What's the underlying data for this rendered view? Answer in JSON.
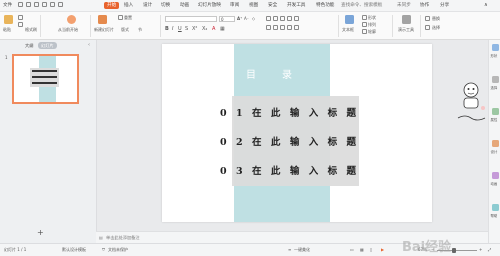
{
  "menubar": {
    "file_label": "文件",
    "tabs": [
      "开始",
      "插入",
      "设计",
      "切换",
      "动画",
      "幻灯片放映",
      "审阅",
      "视图",
      "安全",
      "开发工具",
      "特色功能"
    ],
    "search_placeholder": "查找命令、搜索模板",
    "sync_label": "未同步",
    "collab_label": "协作",
    "share_label": "分享"
  },
  "ribbon": {
    "paste_label": "粘贴",
    "format_painter_label": "格式刷",
    "current_page_label": "从当前开始",
    "new_slide_label": "新建幻灯片",
    "layout_label": "版式",
    "section_label": "节",
    "reset_label": "重置",
    "textbox_label": "文本框",
    "shape_label": "形状",
    "arrange_label": "排列",
    "outline_label": "轮廓",
    "presenter_label": "演示工具",
    "replace_label": "替换",
    "select_label": "选择",
    "font_size_value": "0",
    "font_name_value": ""
  },
  "leftpanel": {
    "tab_outline": "大纲",
    "tab_slides": "幻灯片",
    "thumb_number": "1",
    "add_slide_symbol": "+"
  },
  "slide": {
    "title": "目录",
    "rows": [
      "01在此输入标题",
      "02在此输入标题",
      "03在此输入标题"
    ]
  },
  "notes": {
    "placeholder": "单击此处添加备注"
  },
  "rightbar": {
    "items": [
      "形状",
      "选择",
      "属性",
      "设计",
      "动画",
      "帮助"
    ]
  },
  "statusbar": {
    "slide_indicator": "幻灯片 1 / 1",
    "theme_name": "默认设计模板",
    "protect_label": "文档未保护",
    "beautify_label": "一键美化",
    "zoom_value": "67%"
  },
  "watermark": {
    "text": "Bai经验"
  },
  "colors": {
    "accent": "#e8632d",
    "teal_panel": "#bfe0e3",
    "gray_panel": "#dcdcdc",
    "thumb_border": "#f08a5d"
  }
}
